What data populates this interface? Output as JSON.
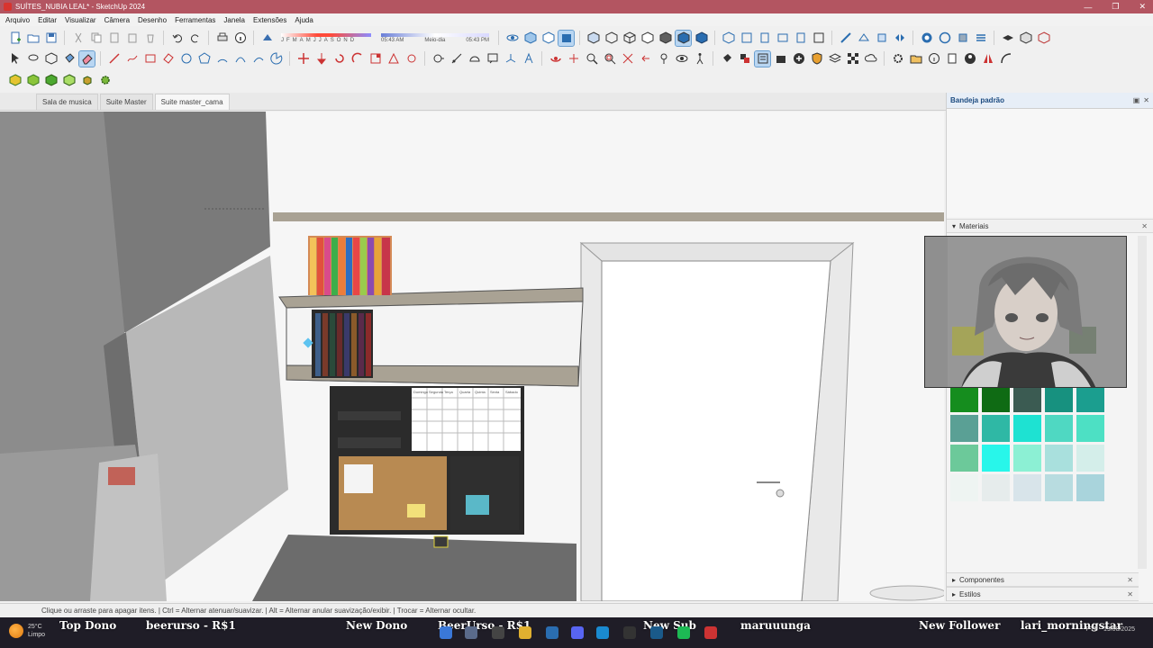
{
  "window": {
    "title": "SUÍTES_NUBIA LEAL* - SketchUp 2024",
    "controls": [
      "—",
      "❐",
      "✕"
    ],
    "ghost_text": "—  ❐  ✕"
  },
  "menu": [
    "Arquivo",
    "Editar",
    "Visualizar",
    "Câmera",
    "Desenho",
    "Ferramentas",
    "Janela",
    "Extensões",
    "Ajuda"
  ],
  "shadows": {
    "months": [
      "J",
      "F",
      "M",
      "A",
      "M",
      "J",
      "J",
      "A",
      "S",
      "O",
      "N",
      "D"
    ],
    "time_start": "05:43 AM",
    "time_mid": "Meio-dia",
    "time_end": "05:43 PM"
  },
  "scene_tabs": [
    "Sala de musica",
    "Suite Master",
    "Suite master_cama"
  ],
  "active_scene": "Suite master_cama",
  "viewport": {
    "calendar_days": [
      "Domingo",
      "Segunda",
      "Terça",
      "Quarta",
      "Quinta",
      "Sexta",
      "Sábado"
    ]
  },
  "tray": {
    "title": "Bandeja padrão",
    "materials_label": "Materiais",
    "components_label": "Componentes",
    "styles_label": "Estilos",
    "swatches": [
      "#e6efe6",
      "#8ef07e",
      "#90ec8a",
      "#4fe04a",
      "#22f07a",
      "#1ef08c",
      "#9bc39a",
      "#4dbd77",
      "#35a36a",
      "#2f9a34",
      "#158d1e",
      "#0f6b14",
      "#3b5b52",
      "#17917f",
      "#1b9e8f",
      "#5aa095",
      "#2fb8a5",
      "#1ee2d2",
      "#4fd8c2",
      "#4de0c4",
      "#6cc99a",
      "#28f6ea",
      "#8cf0d4",
      "#a9e0dd",
      "#d4eeea",
      "#eef4f2",
      "#e6ecec",
      "#d8e4ea",
      "#b8dce0",
      "#a9d4dc"
    ]
  },
  "status": {
    "message": "Clique ou arraste para apagar itens. | Ctrl = Alternar atenuar/suavizar. | Alt = Alternar anular suavização/exibir. | Trocar = Alternar ocultar."
  },
  "taskbar": {
    "weather_temp": "25°C",
    "weather_desc": "Limpo",
    "ticker": {
      "top_donor_label": "Top Dono",
      "top_donor_value": "beerurso - R$1",
      "new_donor_label": "New Dono",
      "new_donor_value": "BeerUrso - R$1",
      "new_sub_label": "New Sub",
      "new_sub_value": "maruuunga",
      "new_follower_label": "New Follower",
      "new_follower_value": "lari_morningstar"
    },
    "lang": "PTB",
    "date": "19/08/2025"
  }
}
